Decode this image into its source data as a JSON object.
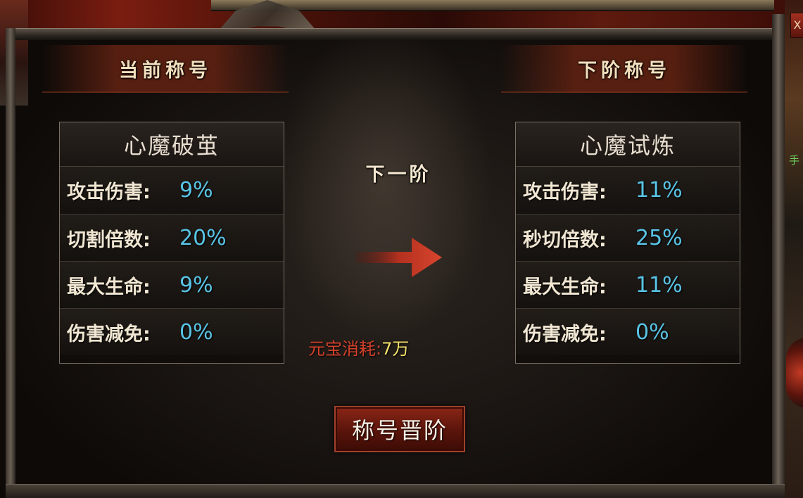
{
  "header": {
    "current_title_tab": "当前称号",
    "next_title_tab": "下阶称号"
  },
  "current": {
    "name": "心魔破茧",
    "stats": [
      {
        "label": "攻击伤害:",
        "value": "9%"
      },
      {
        "label": "切割倍数:",
        "value": "20%"
      },
      {
        "label": "最大生命:",
        "value": "9%"
      },
      {
        "label": "伤害减免:",
        "value": "0%"
      }
    ]
  },
  "next": {
    "name": "心魔试炼",
    "stats": [
      {
        "label": "攻击伤害:",
        "value": "11%"
      },
      {
        "label": "秒切倍数:",
        "value": "25%"
      },
      {
        "label": "最大生命:",
        "value": "11%"
      },
      {
        "label": "伤害减免:",
        "value": "0%"
      }
    ]
  },
  "center": {
    "next_tier_label": "下一阶",
    "cost_label": "元宝消耗:",
    "cost_value": "7万"
  },
  "actions": {
    "upgrade_button": "称号晋阶",
    "close_label": "X"
  },
  "side": {
    "partial_text": "手"
  },
  "colors": {
    "stat_value": "#59c4e6",
    "cost_label": "#d2412a",
    "cost_value": "#f4e36a",
    "arrow": "#c2382a",
    "button": "#6a1a0e"
  },
  "icons": {
    "arrow": "right-arrow-icon",
    "close": "close-icon"
  }
}
